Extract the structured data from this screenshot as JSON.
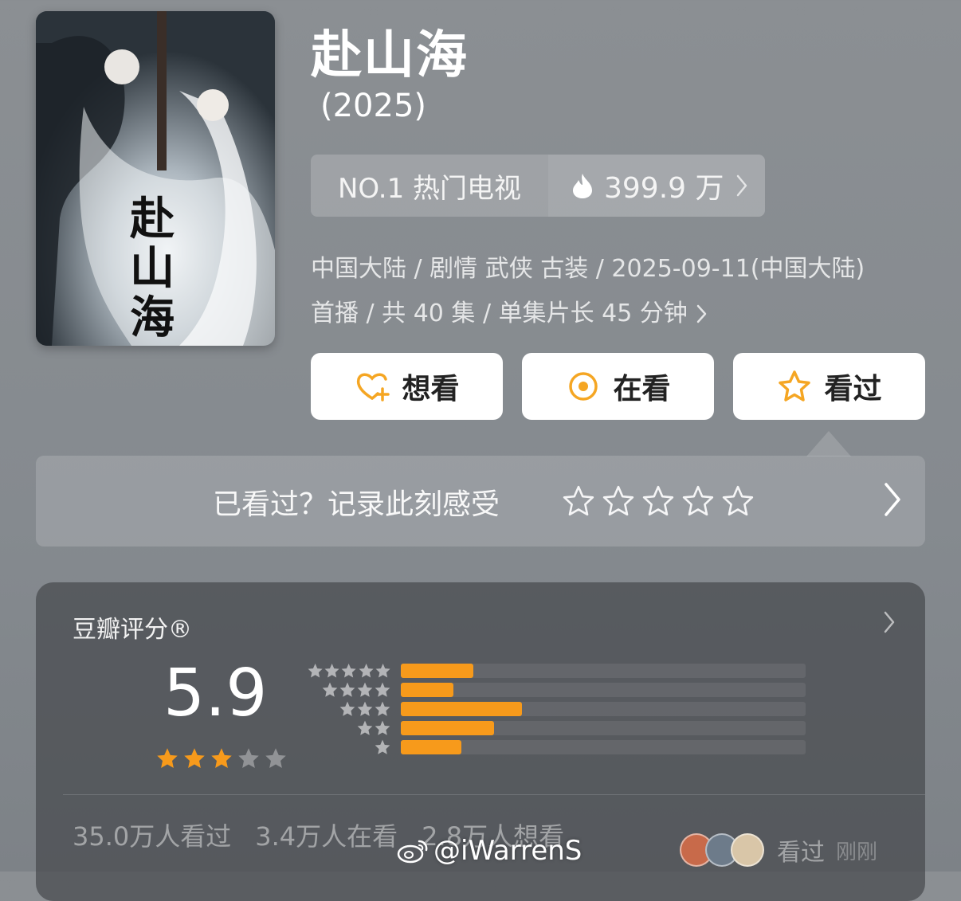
{
  "header": {
    "title": "赴山海",
    "year": "(2025)"
  },
  "poster": {
    "calligraphy": "赴山海"
  },
  "ranking": {
    "label": "NO.1 热门电视",
    "heat": "399.9 万",
    "heat_icon": "flame-icon"
  },
  "meta": {
    "line1": "中国大陆 / 剧情 武侠 古装 / 2025-09-11(中国大陆)",
    "line2": "首播 / 共 40 集 / 单集片长 45 分钟"
  },
  "actions": {
    "want": "想看",
    "watching": "在看",
    "watched": "看过"
  },
  "rate_prompt": {
    "text": "已看过？记录此刻感受",
    "stars": 5
  },
  "rating": {
    "label": "豆瓣评分®",
    "score": "5.9",
    "stars": 3,
    "distribution": [
      {
        "stars": 5,
        "percent": 18
      },
      {
        "stars": 4,
        "percent": 13
      },
      {
        "stars": 3,
        "percent": 30
      },
      {
        "stars": 2,
        "percent": 23
      },
      {
        "stars": 1,
        "percent": 15
      }
    ],
    "colors": {
      "accent": "#f79a1b"
    }
  },
  "stats": {
    "watched": "35.0万人看过",
    "watching": "3.4万人在看",
    "want": "2.8万人想看"
  },
  "friends": {
    "action": "看过",
    "time": "刚刚"
  },
  "watermark": "@iWarrenS"
}
